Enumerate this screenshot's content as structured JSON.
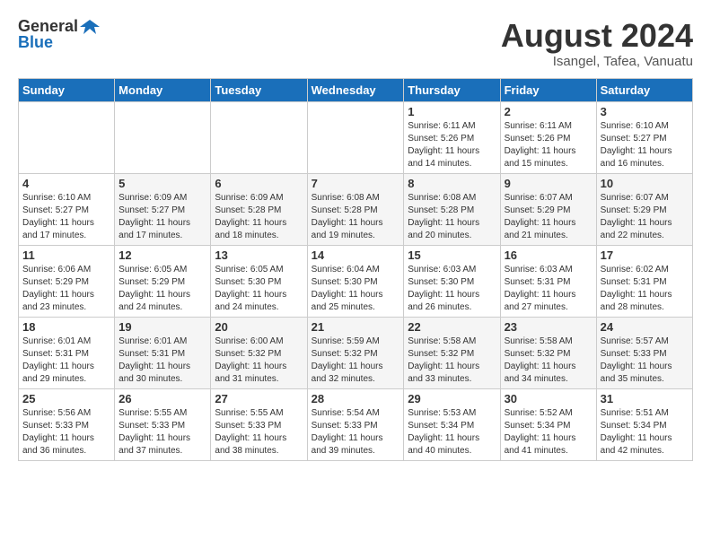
{
  "logo": {
    "general": "General",
    "blue": "Blue"
  },
  "title": {
    "month_year": "August 2024",
    "location": "Isangel, Tafea, Vanuatu"
  },
  "headers": [
    "Sunday",
    "Monday",
    "Tuesday",
    "Wednesday",
    "Thursday",
    "Friday",
    "Saturday"
  ],
  "weeks": [
    [
      {
        "day": "",
        "info": ""
      },
      {
        "day": "",
        "info": ""
      },
      {
        "day": "",
        "info": ""
      },
      {
        "day": "",
        "info": ""
      },
      {
        "day": "1",
        "info": "Sunrise: 6:11 AM\nSunset: 5:26 PM\nDaylight: 11 hours and 14 minutes."
      },
      {
        "day": "2",
        "info": "Sunrise: 6:11 AM\nSunset: 5:26 PM\nDaylight: 11 hours and 15 minutes."
      },
      {
        "day": "3",
        "info": "Sunrise: 6:10 AM\nSunset: 5:27 PM\nDaylight: 11 hours and 16 minutes."
      }
    ],
    [
      {
        "day": "4",
        "info": "Sunrise: 6:10 AM\nSunset: 5:27 PM\nDaylight: 11 hours and 17 minutes."
      },
      {
        "day": "5",
        "info": "Sunrise: 6:09 AM\nSunset: 5:27 PM\nDaylight: 11 hours and 17 minutes."
      },
      {
        "day": "6",
        "info": "Sunrise: 6:09 AM\nSunset: 5:28 PM\nDaylight: 11 hours and 18 minutes."
      },
      {
        "day": "7",
        "info": "Sunrise: 6:08 AM\nSunset: 5:28 PM\nDaylight: 11 hours and 19 minutes."
      },
      {
        "day": "8",
        "info": "Sunrise: 6:08 AM\nSunset: 5:28 PM\nDaylight: 11 hours and 20 minutes."
      },
      {
        "day": "9",
        "info": "Sunrise: 6:07 AM\nSunset: 5:29 PM\nDaylight: 11 hours and 21 minutes."
      },
      {
        "day": "10",
        "info": "Sunrise: 6:07 AM\nSunset: 5:29 PM\nDaylight: 11 hours and 22 minutes."
      }
    ],
    [
      {
        "day": "11",
        "info": "Sunrise: 6:06 AM\nSunset: 5:29 PM\nDaylight: 11 hours and 23 minutes."
      },
      {
        "day": "12",
        "info": "Sunrise: 6:05 AM\nSunset: 5:29 PM\nDaylight: 11 hours and 24 minutes."
      },
      {
        "day": "13",
        "info": "Sunrise: 6:05 AM\nSunset: 5:30 PM\nDaylight: 11 hours and 24 minutes."
      },
      {
        "day": "14",
        "info": "Sunrise: 6:04 AM\nSunset: 5:30 PM\nDaylight: 11 hours and 25 minutes."
      },
      {
        "day": "15",
        "info": "Sunrise: 6:03 AM\nSunset: 5:30 PM\nDaylight: 11 hours and 26 minutes."
      },
      {
        "day": "16",
        "info": "Sunrise: 6:03 AM\nSunset: 5:31 PM\nDaylight: 11 hours and 27 minutes."
      },
      {
        "day": "17",
        "info": "Sunrise: 6:02 AM\nSunset: 5:31 PM\nDaylight: 11 hours and 28 minutes."
      }
    ],
    [
      {
        "day": "18",
        "info": "Sunrise: 6:01 AM\nSunset: 5:31 PM\nDaylight: 11 hours and 29 minutes."
      },
      {
        "day": "19",
        "info": "Sunrise: 6:01 AM\nSunset: 5:31 PM\nDaylight: 11 hours and 30 minutes."
      },
      {
        "day": "20",
        "info": "Sunrise: 6:00 AM\nSunset: 5:32 PM\nDaylight: 11 hours and 31 minutes."
      },
      {
        "day": "21",
        "info": "Sunrise: 5:59 AM\nSunset: 5:32 PM\nDaylight: 11 hours and 32 minutes."
      },
      {
        "day": "22",
        "info": "Sunrise: 5:58 AM\nSunset: 5:32 PM\nDaylight: 11 hours and 33 minutes."
      },
      {
        "day": "23",
        "info": "Sunrise: 5:58 AM\nSunset: 5:32 PM\nDaylight: 11 hours and 34 minutes."
      },
      {
        "day": "24",
        "info": "Sunrise: 5:57 AM\nSunset: 5:33 PM\nDaylight: 11 hours and 35 minutes."
      }
    ],
    [
      {
        "day": "25",
        "info": "Sunrise: 5:56 AM\nSunset: 5:33 PM\nDaylight: 11 hours and 36 minutes."
      },
      {
        "day": "26",
        "info": "Sunrise: 5:55 AM\nSunset: 5:33 PM\nDaylight: 11 hours and 37 minutes."
      },
      {
        "day": "27",
        "info": "Sunrise: 5:55 AM\nSunset: 5:33 PM\nDaylight: 11 hours and 38 minutes."
      },
      {
        "day": "28",
        "info": "Sunrise: 5:54 AM\nSunset: 5:33 PM\nDaylight: 11 hours and 39 minutes."
      },
      {
        "day": "29",
        "info": "Sunrise: 5:53 AM\nSunset: 5:34 PM\nDaylight: 11 hours and 40 minutes."
      },
      {
        "day": "30",
        "info": "Sunrise: 5:52 AM\nSunset: 5:34 PM\nDaylight: 11 hours and 41 minutes."
      },
      {
        "day": "31",
        "info": "Sunrise: 5:51 AM\nSunset: 5:34 PM\nDaylight: 11 hours and 42 minutes."
      }
    ]
  ]
}
